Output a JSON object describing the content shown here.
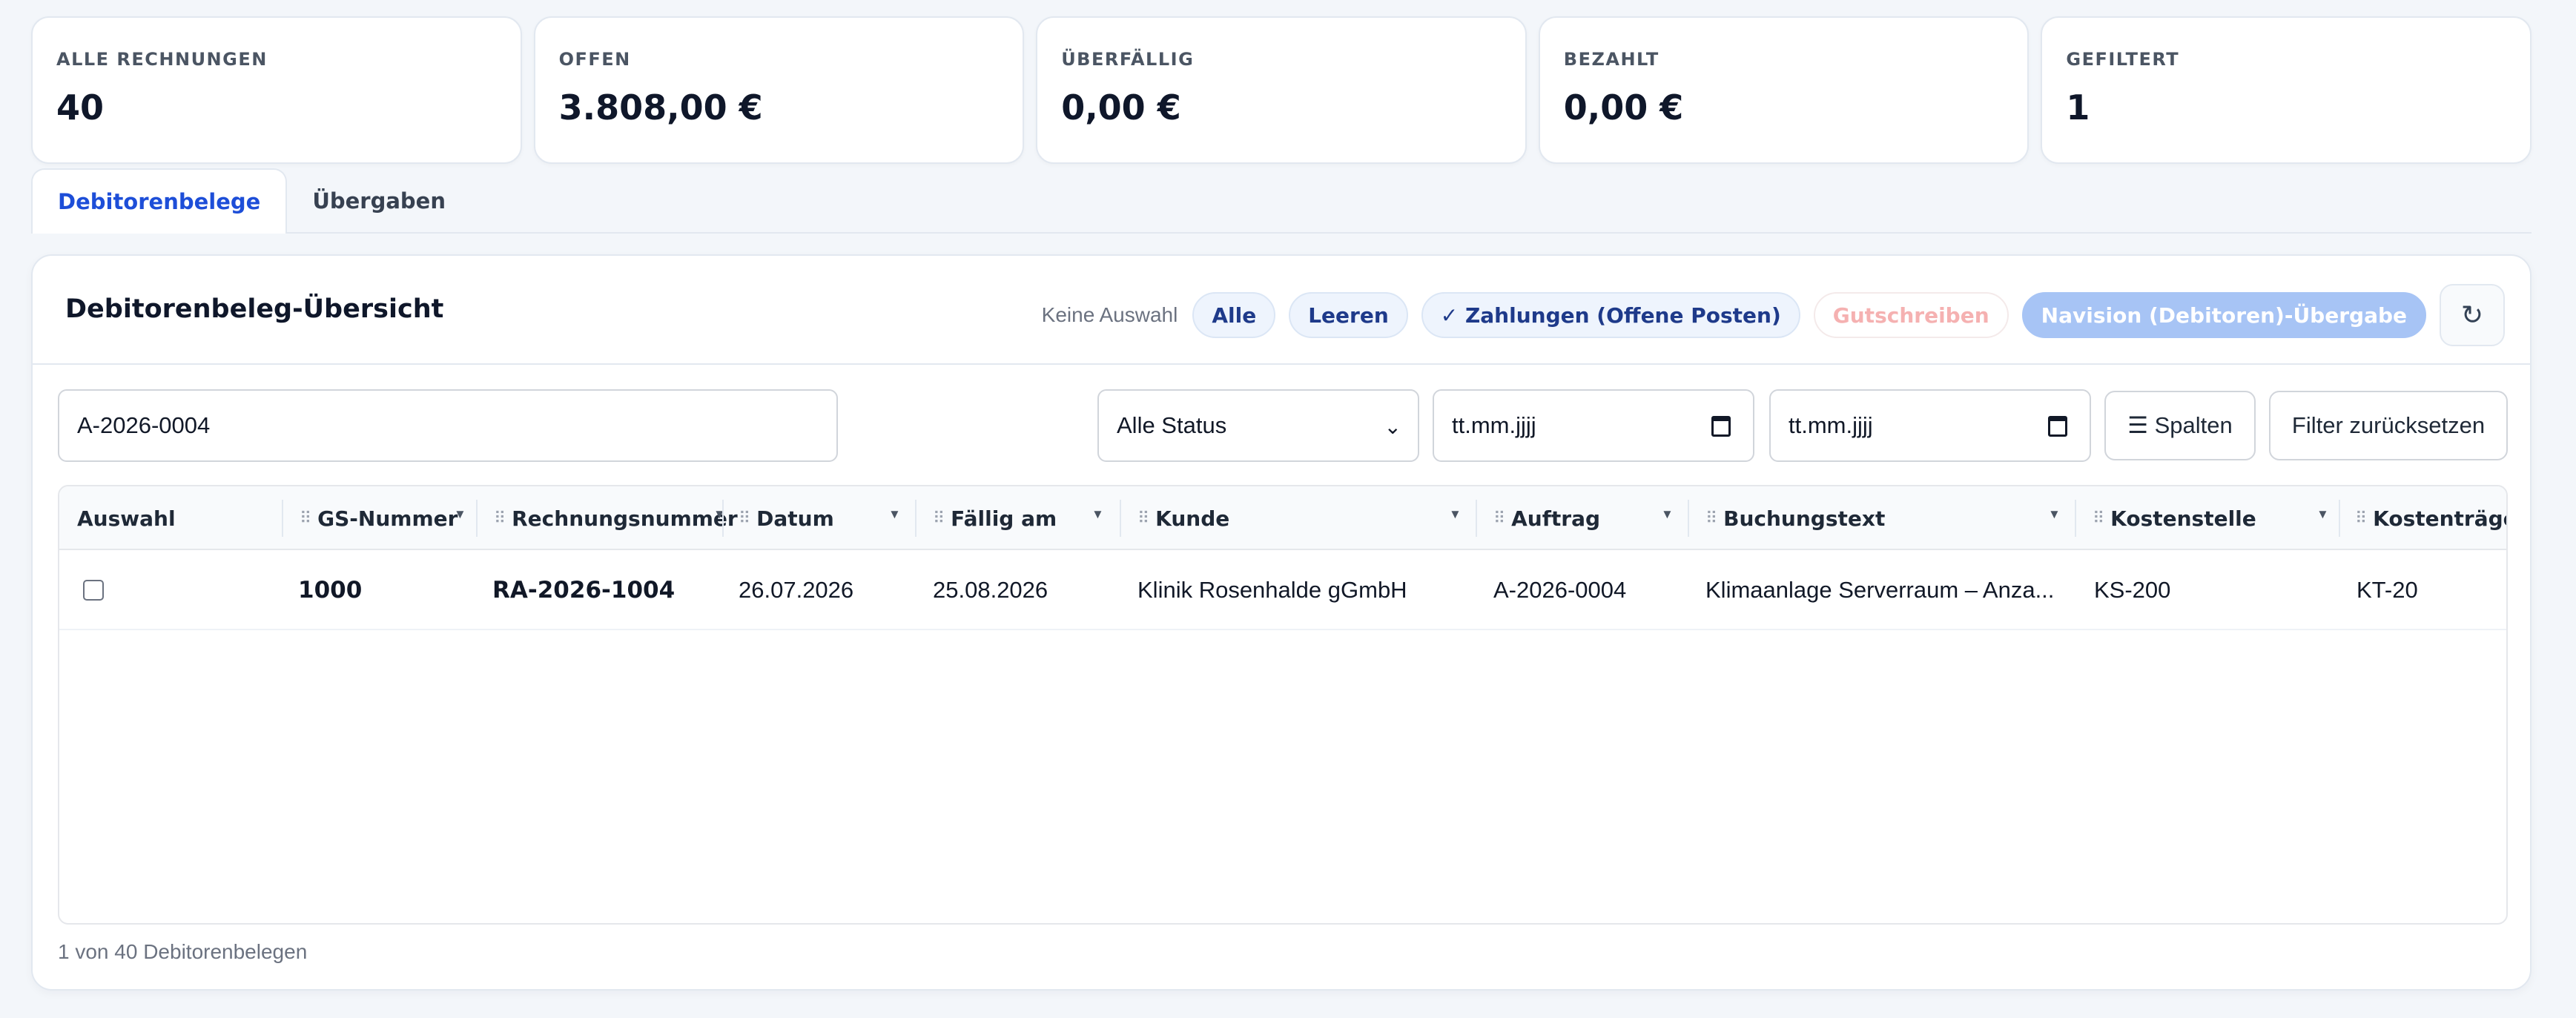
{
  "stats": [
    {
      "label": "ALLE RECHNUNGEN",
      "value": "40"
    },
    {
      "label": "OFFEN",
      "value": "3.808,00 €"
    },
    {
      "label": "ÜBERFÄLLIG",
      "value": "0,00 €"
    },
    {
      "label": "BEZAHLT",
      "value": "0,00 €"
    },
    {
      "label": "GEFILTERT",
      "value": "1"
    }
  ],
  "tabs": [
    {
      "label": "Debitorenbelege",
      "active": true
    },
    {
      "label": "Übergaben",
      "active": false
    }
  ],
  "card": {
    "title": "Debitorenbeleg-Übersicht",
    "selection_text": "Keine Auswahl",
    "actions": {
      "all": "Alle",
      "clear": "Leeren",
      "payments": "✓ Zahlungen (Offene Posten)",
      "credit": "Gutschreiben",
      "navision": "Navision (Debitoren)-Übergabe",
      "refresh_icon": "refresh-icon"
    }
  },
  "filters": {
    "search_value": "A-2026-0004",
    "status_selected": "Alle Status",
    "date_from_placeholder": "tt.mm.jjjj",
    "date_to_placeholder": "tt.mm.jjjj",
    "columns_label": "☰ Spalten",
    "reset_label": "Filter zurücksetzen"
  },
  "table": {
    "headers": {
      "select": "Auswahl",
      "gs_number": "GS-Nummer",
      "invoice_number": "Rechnungsnummer",
      "date": "Datum",
      "due_date": "Fällig am",
      "customer": "Kunde",
      "order": "Auftrag",
      "booking_text": "Buchungstext",
      "cost_center": "Kostenstelle",
      "cost_unit": "Kostenträger"
    },
    "rows": [
      {
        "gs_number": "1000",
        "invoice_number": "RA-2026-1004",
        "date": "26.07.2026",
        "due_date": "25.08.2026",
        "customer": "Klinik Rosenhalde gGmbH",
        "order": "A-2026-0004",
        "booking_text": "Klimaanlage Serverraum – Anza...",
        "cost_center": "KS-200",
        "cost_unit": "KT-20"
      }
    ]
  },
  "footer": {
    "count_text": "1 von 40 Debitorenbelegen"
  }
}
